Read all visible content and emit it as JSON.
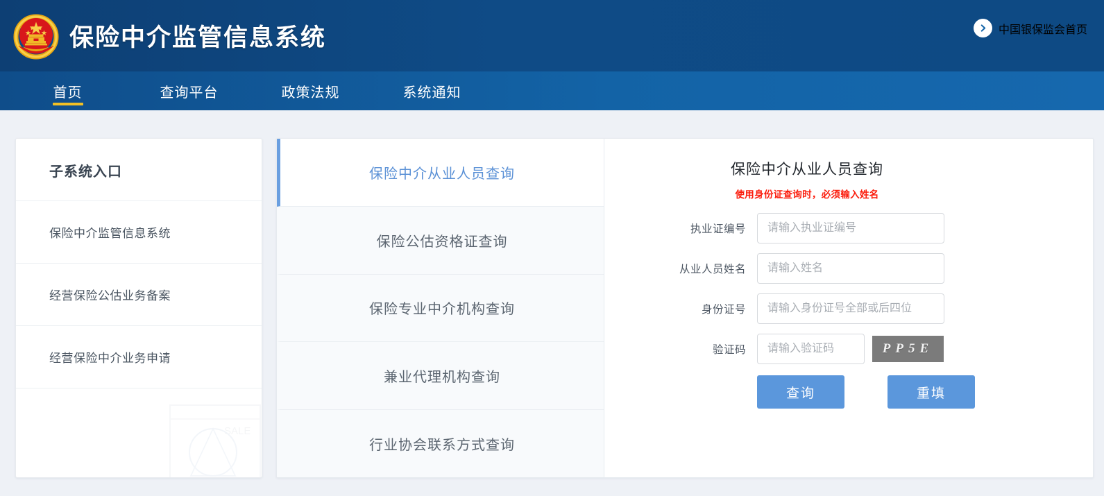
{
  "header": {
    "emblem_icon": "china-national-emblem-icon",
    "site_title": "保险中介监管信息系统",
    "right_link": {
      "label": "中国银保监会首页",
      "icon": "arrow-right-circle-icon"
    },
    "colors": {
      "header_bg": "#0e4a84",
      "nav_bg": "#1566ab",
      "nav_active_underline": "#f2c024"
    }
  },
  "nav": {
    "items": [
      {
        "label": "首页",
        "active": true
      },
      {
        "label": "查询平台",
        "active": false
      },
      {
        "label": "政策法规",
        "active": false
      },
      {
        "label": "系统通知",
        "active": false
      }
    ]
  },
  "sidebar": {
    "title": "子系统入口",
    "items": [
      {
        "label": "保险中介监管信息系统"
      },
      {
        "label": "经营保险公估业务备案"
      },
      {
        "label": "经营保险中介业务申请"
      }
    ]
  },
  "tabs": [
    {
      "label": "保险中介从业人员查询",
      "active": true
    },
    {
      "label": "保险公估资格证查询",
      "active": false
    },
    {
      "label": "保险专业中介机构查询",
      "active": false
    },
    {
      "label": "兼业代理机构查询",
      "active": false
    },
    {
      "label": "行业协会联系方式查询",
      "active": false
    }
  ],
  "form": {
    "title": "保险中介从业人员查询",
    "warning": "使用身份证查询时，必须输入姓名",
    "fields": [
      {
        "label": "执业证编号",
        "placeholder": "请输入执业证编号",
        "value": ""
      },
      {
        "label": "从业人员姓名",
        "placeholder": "请输入姓名",
        "value": ""
      },
      {
        "label": "身份证号",
        "placeholder": "请输入身份证号全部或后四位",
        "value": ""
      }
    ],
    "captcha": {
      "label": "验证码",
      "placeholder": "请输入验证码",
      "value": "",
      "image_text": "PP5E",
      "image_bg": "#7b7b7b"
    },
    "buttons": {
      "submit_label": "查询",
      "reset_label": "重填",
      "color": "#5b97dc"
    }
  }
}
